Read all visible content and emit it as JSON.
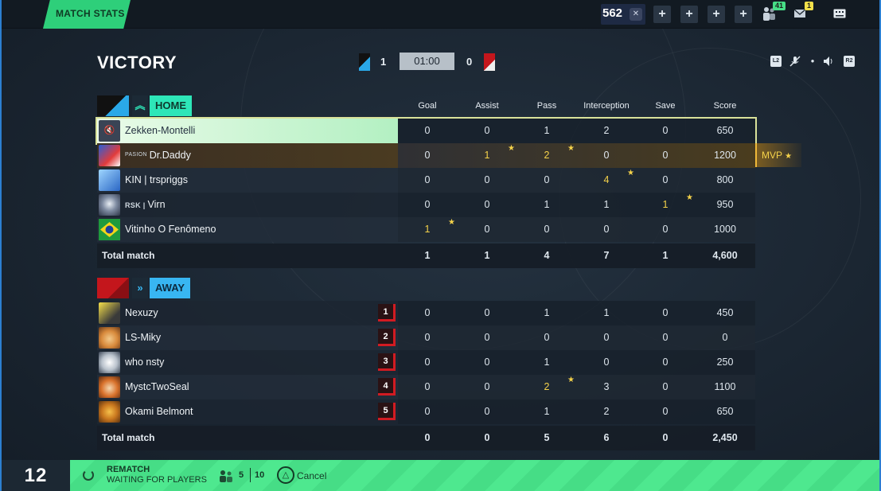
{
  "topbar": {
    "tab_label": "MATCH STATS",
    "level": "562",
    "friends_badge": "41",
    "mail_badge": "1",
    "plus_buttons": [
      "+",
      "+",
      "+",
      "+"
    ]
  },
  "header": {
    "result": "VICTORY",
    "home_score": "1",
    "away_score": "0",
    "timer": "01:00"
  },
  "columns": [
    "Goal",
    "Assist",
    "Pass",
    "Interception",
    "Save",
    "Score"
  ],
  "home": {
    "label": "HOME",
    "players": [
      {
        "name": "Zekken-Montelli",
        "tag": "",
        "goal": "0",
        "assist": "0",
        "pass": "1",
        "interception": "2",
        "save": "0",
        "score": "650"
      },
      {
        "name": "Dr.Daddy",
        "tag": "PASION",
        "goal": "0",
        "assist": "1",
        "pass": "2",
        "interception": "0",
        "save": "0",
        "score": "1200"
      },
      {
        "name": "trspriggs",
        "tag": "KIN |",
        "goal": "0",
        "assist": "0",
        "pass": "0",
        "interception": "4",
        "save": "0",
        "score": "800"
      },
      {
        "name": "Virn",
        "tag": "RSK |",
        "goal": "0",
        "assist": "0",
        "pass": "1",
        "interception": "1",
        "save": "1",
        "score": "950"
      },
      {
        "name": "Vitinho O Fenômeno",
        "tag": "",
        "goal": "1",
        "assist": "0",
        "pass": "0",
        "interception": "0",
        "save": "0",
        "score": "1000"
      }
    ],
    "total": {
      "label": "Total match",
      "goal": "1",
      "assist": "1",
      "pass": "4",
      "interception": "7",
      "save": "1",
      "score": "4,600"
    },
    "mvp_label": "MVP"
  },
  "away": {
    "label": "AWAY",
    "players": [
      {
        "name": "Nexuzy",
        "rank": "1",
        "goal": "0",
        "assist": "0",
        "pass": "1",
        "interception": "1",
        "save": "0",
        "score": "450"
      },
      {
        "name": "LS-Miky",
        "rank": "2",
        "goal": "0",
        "assist": "0",
        "pass": "0",
        "interception": "0",
        "save": "0",
        "score": "0"
      },
      {
        "name": "who nsty",
        "rank": "3",
        "goal": "0",
        "assist": "0",
        "pass": "1",
        "interception": "0",
        "save": "0",
        "score": "250"
      },
      {
        "name": "MystcTwoSeal",
        "rank": "4",
        "goal": "0",
        "assist": "0",
        "pass": "2",
        "interception": "3",
        "save": "0",
        "score": "1100"
      },
      {
        "name": "Okami Belmont",
        "rank": "5",
        "goal": "0",
        "assist": "0",
        "pass": "1",
        "interception": "2",
        "save": "0",
        "score": "650"
      }
    ],
    "total": {
      "label": "Total match",
      "goal": "0",
      "assist": "0",
      "pass": "5",
      "interception": "6",
      "save": "0",
      "score": "2,450"
    }
  },
  "bottom": {
    "countdown": "12",
    "rematch_title": "REMATCH",
    "rematch_status": "WAITING FOR PLAYERS",
    "players_ready": "5",
    "players_max": "10",
    "cancel_label": "Cancel"
  },
  "colors": {
    "accent_green": "#2ecf7a",
    "home_label": "#2ee6b8",
    "away_label": "#38b6f2",
    "gold": "#f5d24a",
    "away_red": "#d21b22"
  }
}
